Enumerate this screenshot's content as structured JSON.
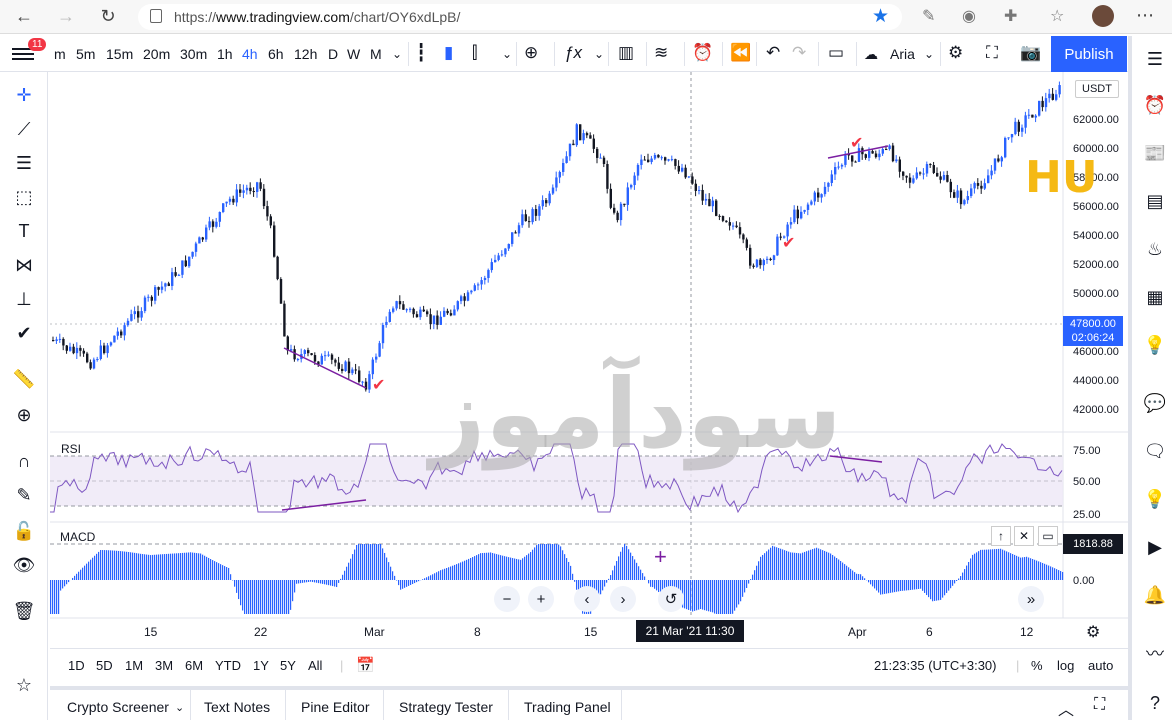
{
  "browser": {
    "url_prefix": "https://",
    "url_domain": "www.tradingview.com",
    "url_path": "/chart/OY6xdLpB/"
  },
  "toolbar": {
    "notification_count": "11",
    "intervals": [
      "m",
      "5m",
      "15m",
      "20m",
      "30m",
      "1h",
      "4h",
      "6h",
      "12h",
      "D",
      "W",
      "M"
    ],
    "active_interval": "4h",
    "font_label": "Aria",
    "publish_label": "Publish"
  },
  "chart": {
    "currency": "USDT",
    "price_ticks": [
      "62000.00",
      "60000.00",
      "58000.00",
      "56000.00",
      "54000.00",
      "52000.00",
      "50000.00",
      "48000.00",
      "46000.00",
      "44000.00",
      "42000.00"
    ],
    "last_price": "47800.00",
    "countdown": "02:06:24",
    "top_price_partial": "6",
    "rsi_label": "RSI",
    "rsi_ticks": [
      "75.00",
      "50.00",
      "25.00"
    ],
    "macd_label": "MACD",
    "macd_value": "1818.88",
    "macd_zero": "0.00",
    "date_ticks": [
      "15",
      "22",
      "Mar",
      "8",
      "15",
      "Apr",
      "6",
      "12"
    ],
    "crosshair_time": "21 Mar '21   11:30",
    "watermark": "سودآموز",
    "logo": "HU",
    "colors": {
      "up": "#2962ff",
      "down": "#131722",
      "annotation": "#7b1fa2",
      "check": "#f23645"
    }
  },
  "range_bar": {
    "ranges": [
      "1D",
      "5D",
      "1M",
      "3M",
      "6M",
      "YTD",
      "1Y",
      "5Y",
      "All"
    ],
    "clock": "21:23:35 (UTC+3:30)",
    "percent": "%",
    "log": "log",
    "auto": "auto"
  },
  "panel": {
    "tabs": [
      "Crypto Screener",
      "Text Notes",
      "Pine Editor",
      "Strategy Tester",
      "Trading Panel"
    ]
  }
}
